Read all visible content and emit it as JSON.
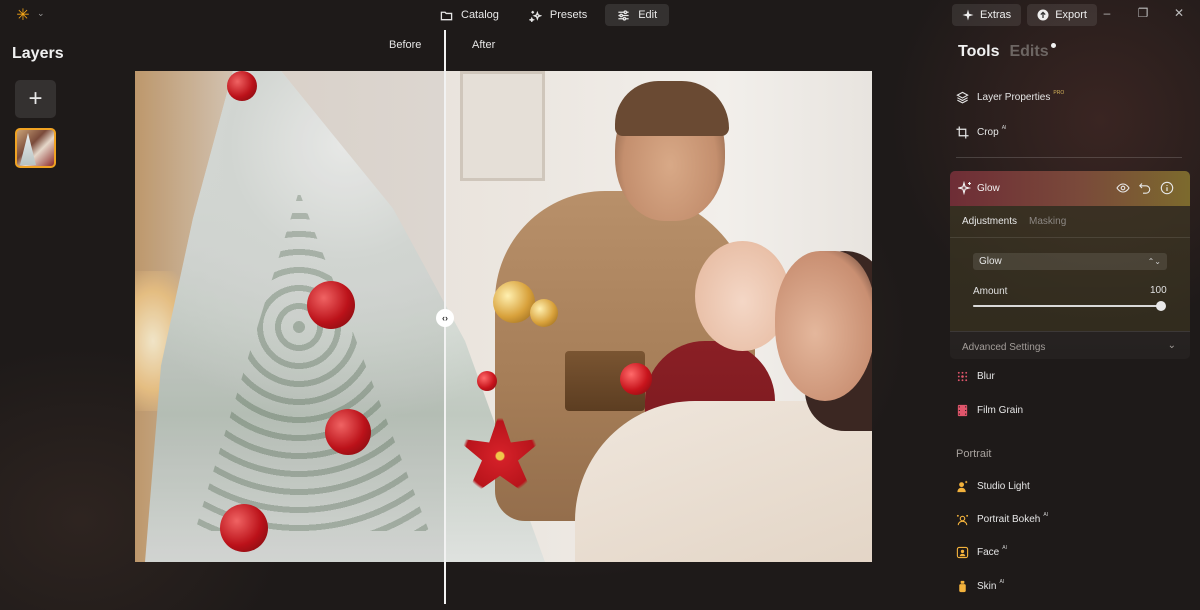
{
  "topbar": {
    "modes": [
      {
        "label": "Catalog",
        "icon": "folder-icon",
        "active": false
      },
      {
        "label": "Presets",
        "icon": "sparkles-icon",
        "active": false
      },
      {
        "label": "Edit",
        "icon": "sliders-icon",
        "active": true
      }
    ],
    "extras_label": "Extras",
    "export_label": "Export"
  },
  "layers": {
    "title": "Layers"
  },
  "compare": {
    "before_label": "Before",
    "after_label": "After"
  },
  "panel": {
    "tab_tools": "Tools",
    "tab_edits": "Edits",
    "tools": [
      {
        "label": "Layer Properties",
        "badge": "PRO",
        "icon": "layers-icon"
      },
      {
        "label": "Crop",
        "badge": "AI",
        "icon": "crop-icon"
      }
    ],
    "glow": {
      "title": "Glow",
      "sub_tabs": [
        "Adjustments",
        "Masking"
      ],
      "select_value": "Glow",
      "amount_label": "Amount",
      "amount_value": "100",
      "amount_fraction": 1.0,
      "advanced_label": "Advanced Settings"
    },
    "more_tools": [
      {
        "label": "Blur",
        "badge": "",
        "icon": "blur-icon"
      },
      {
        "label": "Film Grain",
        "badge": "",
        "icon": "film-icon"
      }
    ],
    "portrait_title": "Portrait",
    "portrait_tools": [
      {
        "label": "Studio Light",
        "badge": "",
        "icon": "studio-light-icon"
      },
      {
        "label": "Portrait Bokeh",
        "badge": "AI",
        "icon": "bokeh-icon"
      },
      {
        "label": "Face",
        "badge": "AI",
        "icon": "face-icon"
      },
      {
        "label": "Skin",
        "badge": "AI",
        "icon": "skin-icon"
      }
    ]
  },
  "colors": {
    "accent": "#f0a323",
    "glow_head_start": "#6e2d36",
    "glow_head_end": "#7c6a2d",
    "pro_badge": "#d4b35a"
  }
}
